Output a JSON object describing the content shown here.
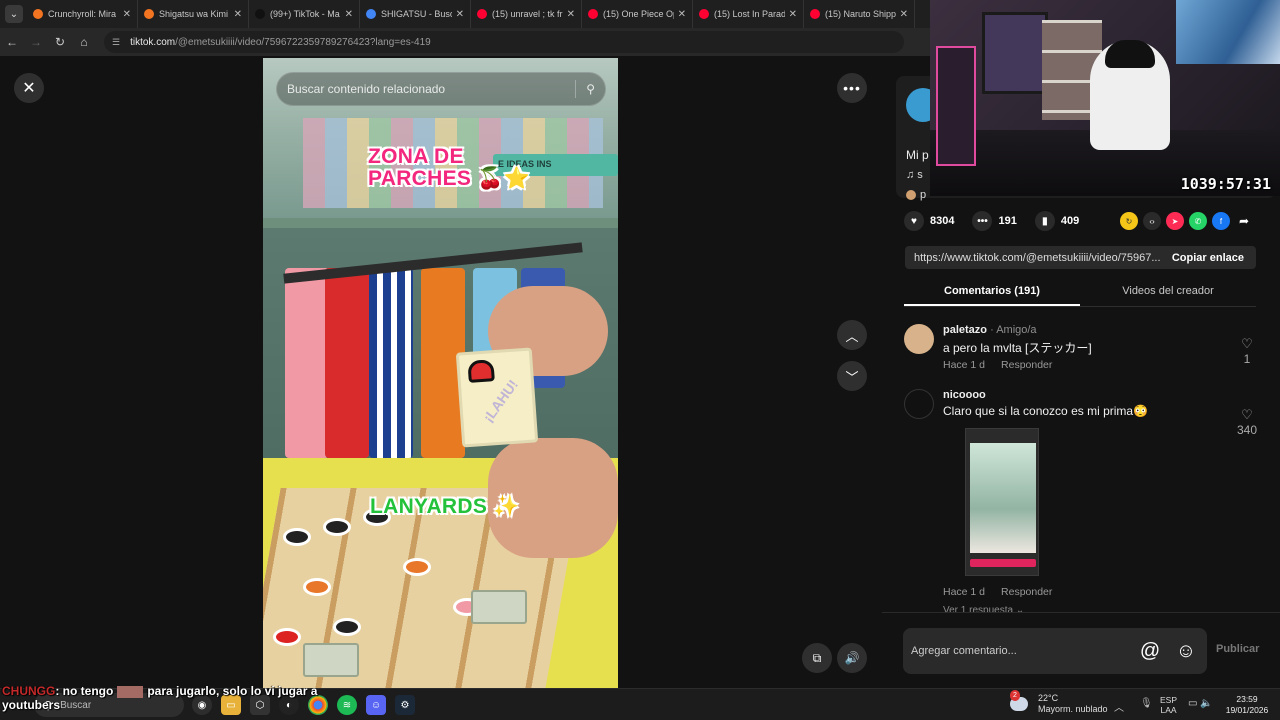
{
  "browser": {
    "tabs": [
      {
        "title": "Crunchyroll: Mira",
        "color": "#f47521"
      },
      {
        "title": "Shigatsu wa Kimi",
        "color": "#f47521"
      },
      {
        "title": "(99+) TikTok - Ma",
        "color": "#111111"
      },
      {
        "title": "SHIGATSU - Busc",
        "color": "#4285f4"
      },
      {
        "title": "(15) unravel ; tk fr",
        "color": "#ff0033"
      },
      {
        "title": "(15) One Piece Op",
        "color": "#ff0033"
      },
      {
        "title": "(15) Lost In Parad",
        "color": "#ff0033"
      },
      {
        "title": "(15) Naruto Shipp",
        "color": "#ff0033"
      }
    ],
    "url_host": "tiktok.com",
    "url_path": "/@emetsukiiii/video/7596722359789276423?lang=es-419"
  },
  "video": {
    "search_placeholder": "Buscar contenido relacionado",
    "overlay_top": "ZONA DE\nPARCHES 🍒⭐",
    "overlay_bottom": "LANYARDS ✨",
    "card_text": "¡LAHU!",
    "sign_text": "E IDEAS INS"
  },
  "creator": {
    "title": "Mi p",
    "music": "♫ s",
    "user": "p"
  },
  "stats": {
    "likes": "8304",
    "comments": "191",
    "saves": "409"
  },
  "link": {
    "url": "https://www.tiktok.com/@emetsukiiii/video/75967...",
    "copy_label": "Copiar enlace"
  },
  "tabs": {
    "comments": "Comentarios (191)",
    "creator_videos": "Videos del creador"
  },
  "comments": [
    {
      "user": "paletazo",
      "badge": "· Amigo/a",
      "text": "a pero la mvlta [ステッカー]",
      "time": "Hace 1 d",
      "reply": "Responder",
      "likes": "1"
    },
    {
      "user": "nicoooo",
      "badge": "",
      "text": "Claro que si la conozco es mi prima😳",
      "time": "Hace 1 d",
      "reply": "Responder",
      "likes": "340"
    }
  ],
  "more_replies": "Ver 1 respuesta ⌄",
  "composer": {
    "placeholder": "Agregar comentario...",
    "publish": "Publicar"
  },
  "stream": {
    "timer": "1039:57:31",
    "chat_user": "CHUNGG",
    "chat_text_1": ": no tengo",
    "chat_text_2": "para jugarlo, solo lo vi jugar a",
    "chat_text_3": "youtubers"
  },
  "taskbar": {
    "search": "Buscar",
    "temp": "22°C",
    "weather": "Mayorm. nublado",
    "weather_badge": "2",
    "lang1": "ESP",
    "lang2": "LAA",
    "time": "23:59",
    "date": "19/01/2026"
  },
  "colors": {
    "accent_pink": "#f2277d",
    "accent_green": "#24c23b",
    "panel_bg": "#121212"
  }
}
